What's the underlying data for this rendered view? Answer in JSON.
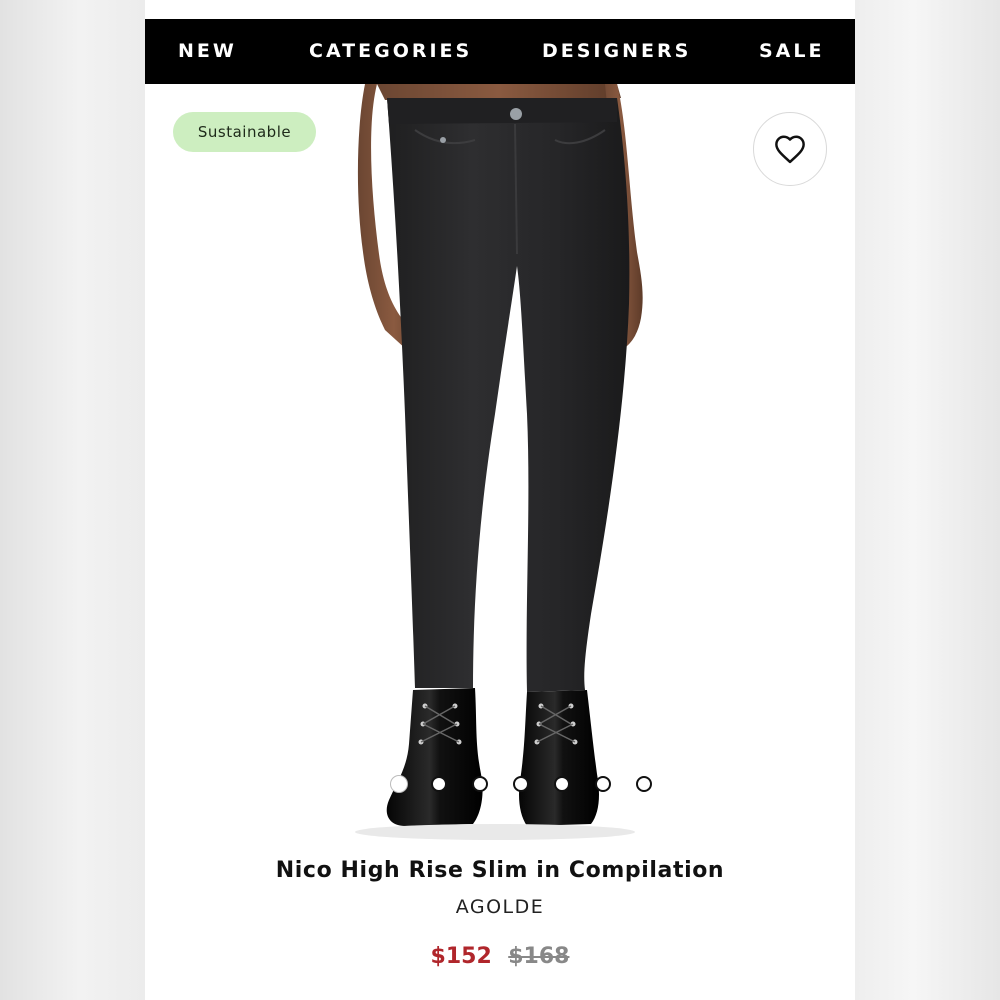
{
  "nav": {
    "items": [
      {
        "label": "NEW"
      },
      {
        "label": "CATEGORIES"
      },
      {
        "label": "DESIGNERS"
      },
      {
        "label": "SALE"
      }
    ]
  },
  "product": {
    "badge": "Sustainable",
    "favorite_icon": "heart-outline-icon",
    "title": "Nico High Rise Slim in Compilation",
    "brand": "AGOLDE",
    "price_sale": "$152",
    "price_original": "$168",
    "colors": {
      "sale_price": "#b0262b",
      "badge_bg": "#cdeec0",
      "nav_bg": "#000000"
    }
  },
  "carousel": {
    "total_images": 7,
    "current_index": 1
  }
}
